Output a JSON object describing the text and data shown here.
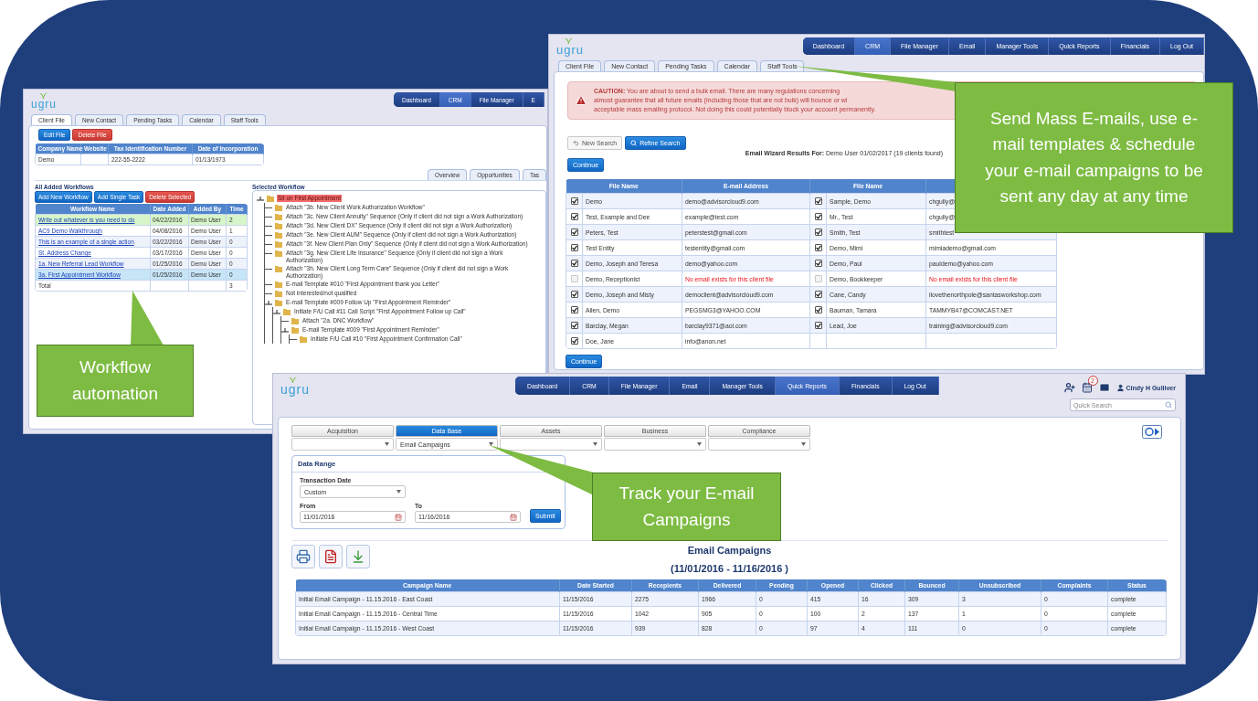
{
  "workflow_screen": {
    "logo": "ugru",
    "nav": [
      {
        "label": "Dashboard",
        "selected": false
      },
      {
        "label": "CRM",
        "selected": true
      },
      {
        "label": "File Manager",
        "selected": false
      },
      {
        "label": "E",
        "selected": false
      }
    ],
    "tabs": [
      {
        "label": "Client File",
        "selected": true
      },
      {
        "label": "New Contact",
        "selected": false
      },
      {
        "label": "Pending Tasks",
        "selected": false
      },
      {
        "label": "Calendar",
        "selected": false
      },
      {
        "label": "Staff Tools",
        "selected": false
      }
    ],
    "file_buttons": [
      {
        "label": "Edit File",
        "kind": "primary"
      },
      {
        "label": "Delete File",
        "kind": "danger"
      }
    ],
    "company_table": {
      "columns": [
        "Company Name",
        "Website",
        "Tax Identification Number",
        "Date of Incorporation"
      ],
      "company_name": "Demo",
      "tax_id": "222-55-2222",
      "date": "01/13/1973"
    },
    "section_tabs": [
      "Overview",
      "Opportunities",
      "Tas"
    ],
    "workflows_title": "All Added Workflows",
    "workflow_buttons": [
      {
        "label": "Add New Workflow",
        "kind": "primary"
      },
      {
        "label": "Add Single Task",
        "kind": "primary"
      },
      {
        "label": "Delete Selected",
        "kind": "danger"
      }
    ],
    "workflow_table": {
      "columns": [
        "Workflow Name",
        "Date Added",
        "Added By",
        "Time"
      ],
      "rows": [
        {
          "name": "Write out whatever is you need to do",
          "date": "04/22/2016",
          "by": "Demo User",
          "time": "2",
          "highlighted": true,
          "selected": false
        },
        {
          "name": "AC9 Demo Walkthrough",
          "date": "04/08/2016",
          "by": "Demo User",
          "time": "1",
          "highlighted": false,
          "selected": false
        },
        {
          "name": "This is an example of a single action",
          "date": "03/22/2016",
          "by": "Demo User",
          "time": "0",
          "highlighted": false,
          "selected": false
        },
        {
          "name": "St. Address Change",
          "date": "03/17/2016",
          "by": "Demo User",
          "time": "0",
          "highlighted": false,
          "selected": false
        },
        {
          "name": "1a. New Referral Lead Workflow",
          "date": "01/25/2016",
          "by": "Demo User",
          "time": "0",
          "highlighted": false,
          "selected": false
        },
        {
          "name": "3a. First Appointment Workflow",
          "date": "01/25/2016",
          "by": "Demo User",
          "time": "0",
          "highlighted": false,
          "selected": true
        }
      ],
      "total_label": "Total",
      "total": "3"
    },
    "selected_workflow_title": "Selected Workflow",
    "tree": [
      {
        "label": "Sit on First Appointment",
        "highlighted": true,
        "children": [
          {
            "label": "Attach \"3b. New Client Work Authorization Workflow\"",
            "highlighted": false
          },
          {
            "label": "Attach \"3c. New Client Annuity\" Sequence (Only if client did not sign a Work Authorization)",
            "highlighted": false
          },
          {
            "label": "Attach \"3d. New Client DX\" Sequence (Only if client did not sign a Work Authorization)",
            "highlighted": false
          },
          {
            "label": "Attach \"3e. New Client AUM\" Sequence (Only if client did not sign a Work Authorization)",
            "highlighted": false
          },
          {
            "label": "Attach \"3f. New Client Plan Only\" Sequence (Only if client did not sign a Work Authorization)",
            "highlighted": false
          },
          {
            "label": "Attach \"3g. New Client Life Insurance\" Sequence (Only if client did not sign a Work Authorization)",
            "highlighted": false
          },
          {
            "label": "Attach \"3h. New Client Long Term Care\" Sequence (Only if client did not sign a Work Authorization)",
            "highlighted": false
          },
          {
            "label": "E-mail Template #010 \"First Appointment thank you Letter\"",
            "highlighted": false
          },
          {
            "label": "Not interested/not qualified",
            "highlighted": false
          },
          {
            "label": "E-mail Template #009 Follow Up \"First Appointment Reminder\"",
            "highlighted": false,
            "children": [
              {
                "label": "Initiate F/U Call #11 Call Script \"First Appointment Follow up Call\"",
                "highlighted": false,
                "children": [
                  {
                    "label": "Attach \"2a. DNC Workflow\"",
                    "highlighted": false
                  },
                  {
                    "label": "E-mail Template #009 \"First Appointment Reminder\"",
                    "highlighted": false,
                    "children": [
                      {
                        "label": "Initiate F/U Call #10 \"First Appointment Confirmation Call\"",
                        "highlighted": false
                      }
                    ]
                  }
                ]
              }
            ]
          }
        ]
      }
    ]
  },
  "email_wizard_screen": {
    "logo": "ugru",
    "nav": [
      {
        "label": "Dashboard",
        "selected": false
      },
      {
        "label": "CRM",
        "selected": true
      },
      {
        "label": "File Manager",
        "selected": false
      },
      {
        "label": "Email",
        "selected": false
      },
      {
        "label": "Manager Tools",
        "selected": false
      },
      {
        "label": "Quick Reports",
        "selected": false
      },
      {
        "label": "Financials",
        "selected": false
      },
      {
        "label": "Log Out",
        "selected": false
      }
    ],
    "tabs": [
      "Client File",
      "New Contact",
      "Pending Tasks",
      "Calendar",
      "Staff Tools"
    ],
    "caution_lines": [
      "**CAUTION:** You are about to send a bulk email. There are many regulations concerning",
      "almost guarantee that all future emails (including those that are not bulk) will bounce or wi",
      "acceptable mass emailing protocol. Not doing this could potentially block your account permanently."
    ],
    "search_buttons": [
      {
        "label": "New Search",
        "kind": "default"
      },
      {
        "label": "Refine Search",
        "kind": "primary"
      }
    ],
    "results": "**Email Wizard Results For:** Demo User 01/02/2017 (19 clients found)",
    "continue_top": "Continue",
    "columns": [
      "File Name",
      "E-mail Address",
      "File Name"
    ],
    "rows": [
      {
        "left": {
          "checked": true,
          "name": "Demo",
          "email": "demo@advisorcloud9.com",
          "no_email": false
        },
        "right": {
          "checked": true,
          "name": "Sample, Demo",
          "email": "chgully@",
          "no_email": false
        }
      },
      {
        "left": {
          "checked": true,
          "name": "Test, Example and Dee",
          "email": "example@test.com",
          "no_email": false
        },
        "right": {
          "checked": true,
          "name": "Mr., Test",
          "email": "chgully@",
          "no_email": false
        }
      },
      {
        "left": {
          "checked": true,
          "name": "Peters, Test",
          "email": "peterstest@gmail.com",
          "no_email": false
        },
        "right": {
          "checked": true,
          "name": "Smith, Test",
          "email": "smithtest",
          "no_email": false
        }
      },
      {
        "left": {
          "checked": true,
          "name": "Test Entity",
          "email": "testentity@gmail.com",
          "no_email": false
        },
        "right": {
          "checked": true,
          "name": "Demo, Mimi",
          "email": "mimiademo@gmail.com",
          "no_email": false
        }
      },
      {
        "left": {
          "checked": true,
          "name": "Demo, Joseph and Teresa",
          "email": "demo@yahoo.com",
          "no_email": false
        },
        "right": {
          "checked": true,
          "name": "Demo, Paul",
          "email": "pauldemo@yahoo.com",
          "no_email": false
        }
      },
      {
        "left": {
          "checked": false,
          "name": "Demo, Receptionist",
          "email": "No email exists for this client file",
          "no_email": true
        },
        "right": {
          "checked": false,
          "name": "Demo, Bookkeeper",
          "email": "No email exists for this client file",
          "no_email": true
        }
      },
      {
        "left": {
          "checked": true,
          "name": "Demo, Joseph and Misty",
          "email": "democlient@advisorcloud9.com",
          "no_email": false
        },
        "right": {
          "checked": true,
          "name": "Cane, Candy",
          "email": "ilovethenorthpole@santasworkshop.com",
          "no_email": false
        }
      },
      {
        "left": {
          "checked": true,
          "name": "Allen, Demo",
          "email": "PEGSMG3@YAHOO.COM",
          "no_email": false
        },
        "right": {
          "checked": true,
          "name": "Bauman, Tamara",
          "email": "TAMMYB47@COMCAST.NET",
          "no_email": false
        }
      },
      {
        "left": {
          "checked": true,
          "name": "Barclay, Megan",
          "email": "barclay9371@aol.com",
          "no_email": false
        },
        "right": {
          "checked": true,
          "name": "Lead, Joe",
          "email": "training@advisorcloud9.com",
          "no_email": false
        }
      },
      {
        "left": {
          "checked": true,
          "name": "Doe, Jane",
          "email": "info@anon.net",
          "no_email": false
        }
      }
    ],
    "continue_bottom": "Continue"
  },
  "reports_screen": {
    "logo": "ugru",
    "nav": [
      {
        "label": "Dashboard",
        "selected": false
      },
      {
        "label": "CRM",
        "selected": false
      },
      {
        "label": "File Manager",
        "selected": false
      },
      {
        "label": "Email",
        "selected": false
      },
      {
        "label": "Manager Tools",
        "selected": false
      },
      {
        "label": "Quick Reports",
        "selected": true
      },
      {
        "label": "Financials",
        "selected": false
      },
      {
        "label": "Log Out",
        "selected": false
      }
    ],
    "calendar_badge": "2",
    "user": "Cindy H Gulliver",
    "search": {
      "placeholder": "Quick Search"
    },
    "categories": [
      {
        "label": "Acquisition",
        "selected": false
      },
      {
        "label": "Data Base",
        "selected": true,
        "value": "Email Campaigns"
      },
      {
        "label": "Assets",
        "selected": false
      },
      {
        "label": "Business",
        "selected": false
      },
      {
        "label": "Compliance",
        "selected": false
      }
    ],
    "data_range": {
      "title": "Data Range",
      "transaction_label": "Transaction Date",
      "transaction_value": "Custom",
      "from_label": "From",
      "from": "11/01/2016",
      "to_label": "To",
      "to": "11/16/2016",
      "submit": "Submit"
    },
    "report_title": "Email Campaigns",
    "report_range": "(11/01/2016 - 11/16/2016 )",
    "table": {
      "columns": [
        "Campaign Name",
        "Date Started",
        "Recepients",
        "Delivered",
        "Pending",
        "Opened",
        "Clicked",
        "Bounced",
        "Unsubscribed",
        "Complaints",
        "Status"
      ],
      "rows": [
        [
          "Initial Email Campaign - 11.15.2016 - East Coast",
          "11/15/2016",
          "2275",
          "1966",
          "0",
          "415",
          "16",
          "309",
          "3",
          "0",
          "complete"
        ],
        [
          "Initial Email Campaign - 11.15.2016 - Central Time",
          "11/15/2016",
          "1042",
          "905",
          "0",
          "100",
          "2",
          "137",
          "1",
          "0",
          "complete"
        ],
        [
          "Initial Email Campaign - 11.15.2016 - West Coast",
          "11/15/2016",
          "939",
          "828",
          "0",
          "97",
          "4",
          "111",
          "0",
          "0",
          "complete"
        ]
      ]
    }
  },
  "callouts": [
    "Workflow automation",
    "Send Mass E-mails, use e-mail templates & schedule your e-mail campaigns to be sent any day at any time",
    "Track your E-mail Campaigns"
  ]
}
